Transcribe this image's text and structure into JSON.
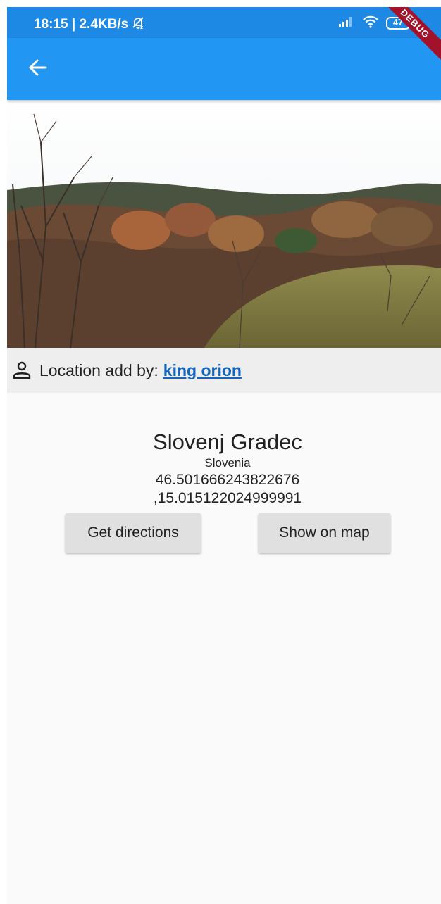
{
  "status_bar": {
    "time_speed": "18:15 | 2.4KB/s",
    "battery": "47",
    "debug_banner": "DEBUG"
  },
  "icons": {
    "back": "arrow-left-icon",
    "mute": "bell-off-icon",
    "signal": "signal-icon",
    "wifi": "wifi-icon",
    "battery": "battery-icon",
    "person": "person-icon"
  },
  "added_by": {
    "label": "Location add by:",
    "user": "king orion"
  },
  "location": {
    "name": "Slovenj Gradec",
    "country": "Slovenia",
    "latitude": "46.501666243822676",
    "longitude": ",15.015122024999991"
  },
  "actions": {
    "directions_label": "Get directions",
    "map_label": "Show on map"
  },
  "colors": {
    "app_bar": "#2196f3",
    "status_bar": "#1e88e5",
    "link": "#1565c0",
    "button": "#e0e0e0"
  }
}
